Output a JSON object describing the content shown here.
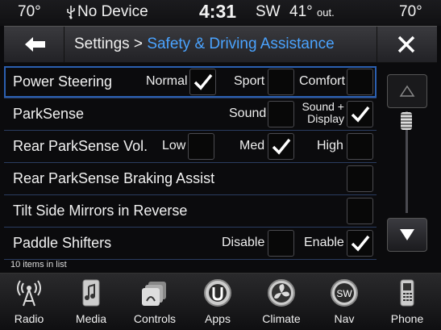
{
  "status": {
    "temp_left": "70°",
    "device": "No Device",
    "time": "4:31",
    "compass": "SW",
    "outside_temp": "41°",
    "outside_label": "out.",
    "temp_right": "70°"
  },
  "header": {
    "crumb_parent": "Settings >",
    "crumb_current": "Safety & Driving Assistance"
  },
  "list": {
    "count_text": "10 items in list",
    "rows": [
      {
        "label": "Power Steering",
        "options": [
          {
            "label": "Normal",
            "checked": true
          },
          {
            "label": "Sport",
            "checked": false
          },
          {
            "label": "Comfort",
            "checked": false
          }
        ]
      },
      {
        "label": "ParkSense",
        "options": [
          {
            "label": "Sound",
            "checked": false
          },
          {
            "label": "Sound +",
            "label2": "Display",
            "checked": true
          }
        ]
      },
      {
        "label": "Rear ParkSense Vol.",
        "options": [
          {
            "label": "Low",
            "checked": false
          },
          {
            "label": "Med",
            "checked": true
          },
          {
            "label": "High",
            "checked": false
          }
        ]
      },
      {
        "label": "Rear ParkSense Braking Assist",
        "checked": false
      },
      {
        "label": "Tilt Side Mirrors in Reverse",
        "checked": false
      },
      {
        "label": "Paddle Shifters",
        "options": [
          {
            "label": "Disable",
            "checked": false
          },
          {
            "label": "Enable",
            "checked": true
          }
        ]
      }
    ]
  },
  "nav": {
    "radio": "Radio",
    "media": "Media",
    "controls": "Controls",
    "apps": "Apps",
    "climate": "Climate",
    "nav": "Nav",
    "nav_badge": "SW",
    "phone": "Phone"
  },
  "colors": {
    "accent": "#4aa3ff",
    "check": "#ffffff"
  }
}
